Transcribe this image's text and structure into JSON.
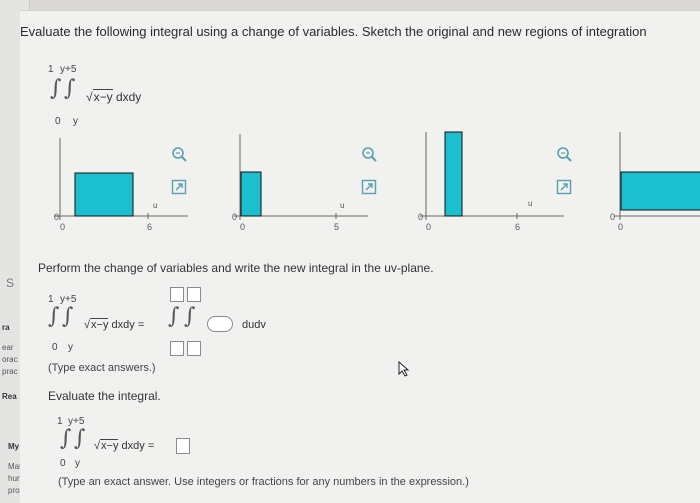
{
  "question": {
    "title": "Evaluate the following integral using a change of variables. Sketch the original and new regions of integration"
  },
  "integral": {
    "outer_upper": "1",
    "inner_upper": "y+5",
    "outer_lower": "0",
    "inner_lower": "y",
    "integrand_radicand": "x−y",
    "differential": "dxdy"
  },
  "graphs": [
    {
      "x_zero": "0",
      "x_tick": "6",
      "u_label": "u",
      "zero_label": "0",
      "fill": "#1bbfd0"
    },
    {
      "x_zero": "0",
      "x_tick": "5",
      "u_label": "u",
      "zero_label": "0",
      "fill": "#1bbfd0"
    },
    {
      "x_zero": "0",
      "x_tick": "6",
      "u_label": "u",
      "zero_label": "0",
      "fill": "#1bbfd0"
    },
    {
      "x_zero": "0",
      "u_label": "",
      "zero_label": "0",
      "fill": "#1bbfd0"
    }
  ],
  "step1": {
    "instruction": "Perform the change of variables and write the new integral in the uv-plane.",
    "equals_lhs": "dxdy =",
    "new_differential": "dudv",
    "hint": "(Type exact answers.)"
  },
  "step2": {
    "instruction": "Evaluate the integral.",
    "equals": "dxdy =",
    "hint": "(Type an exact answer. Use integers or fractions for any numbers in the expression.)"
  },
  "sidebar": {
    "items": [
      "S",
      "ra",
      "ear",
      "orac",
      "prac",
      "Rea",
      "My",
      "Mati",
      "hunt",
      "prot"
    ]
  },
  "colors": {
    "region_fill": "#1bbfd0",
    "icon": "#5aa0b0"
  }
}
